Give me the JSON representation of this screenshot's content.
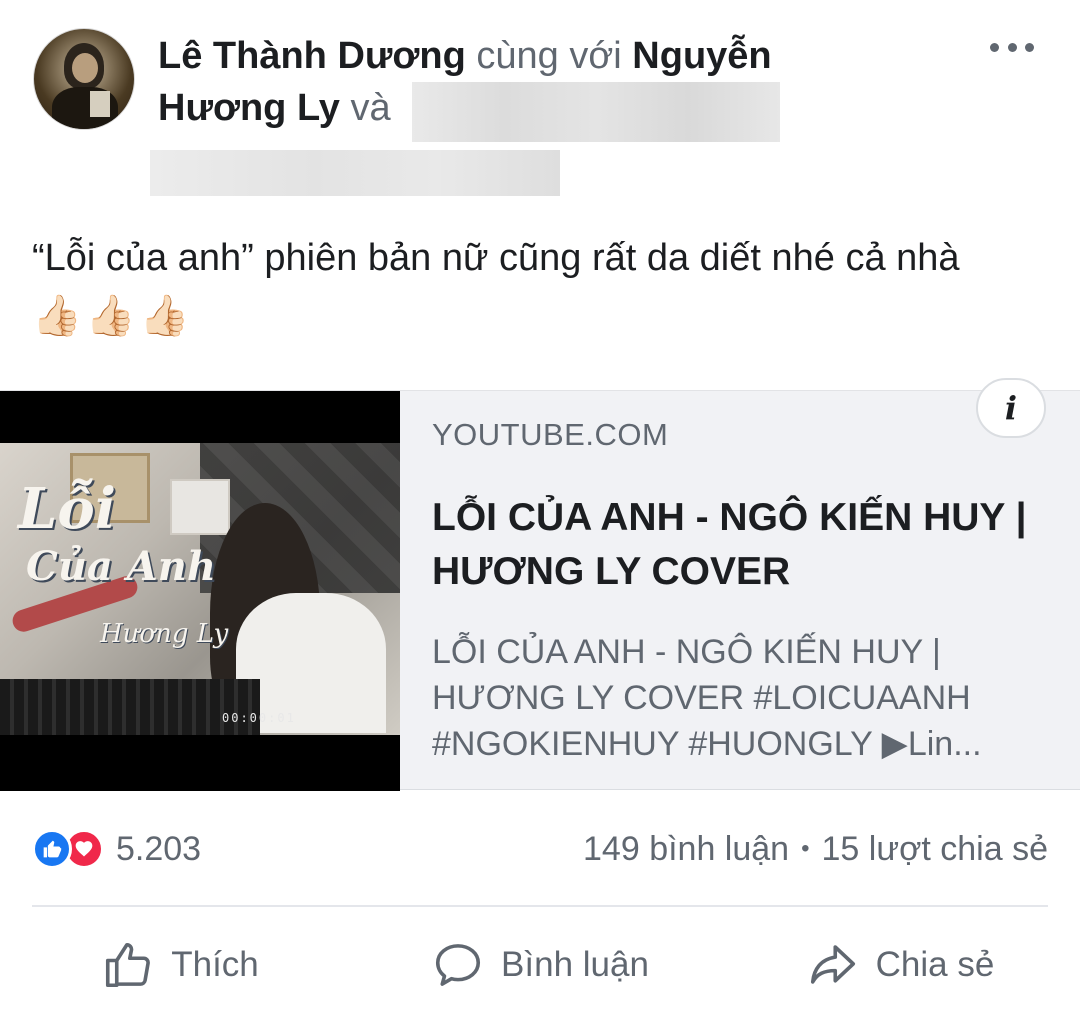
{
  "post": {
    "author": "Lê Thành Dương",
    "with_text": "cùng với",
    "tagged_1_line1": "Nguyễn",
    "tagged_1_line2": "Hương Ly",
    "and_text": "và",
    "body": "“Lỗi của anh” phiên bản nữ cũng rất da diết nhé cả nhà",
    "emoji": "👍🏻👍🏻👍🏻"
  },
  "link_card": {
    "domain": "YOUTUBE.COM",
    "title": "LỖI CỦA ANH - NGÔ KIẾN HUY | HƯƠNG LY COVER",
    "description": "LỖI CỦA ANH - NGÔ KIẾN HUY |\nHƯƠNG LY COVER #LOICUAANH\n#NGOKIENHUY #HUONGLY ▶Lin...",
    "thumb_title_1": "Lỗi",
    "thumb_title_2": "Của Anh",
    "thumb_title_3": "Hương Ly",
    "thumb_time": "00:00:01",
    "info_label": "i"
  },
  "stats": {
    "reactions_count": "5.203",
    "comments": "149 bình luận",
    "separator": "•",
    "shares": "15 lượt chia sẻ"
  },
  "actions": {
    "like": "Thích",
    "comment": "Bình luận",
    "share": "Chia sẻ"
  },
  "colors": {
    "like_blue": "#1877f2",
    "love_red": "#f0284a",
    "muted_text": "#606770"
  }
}
